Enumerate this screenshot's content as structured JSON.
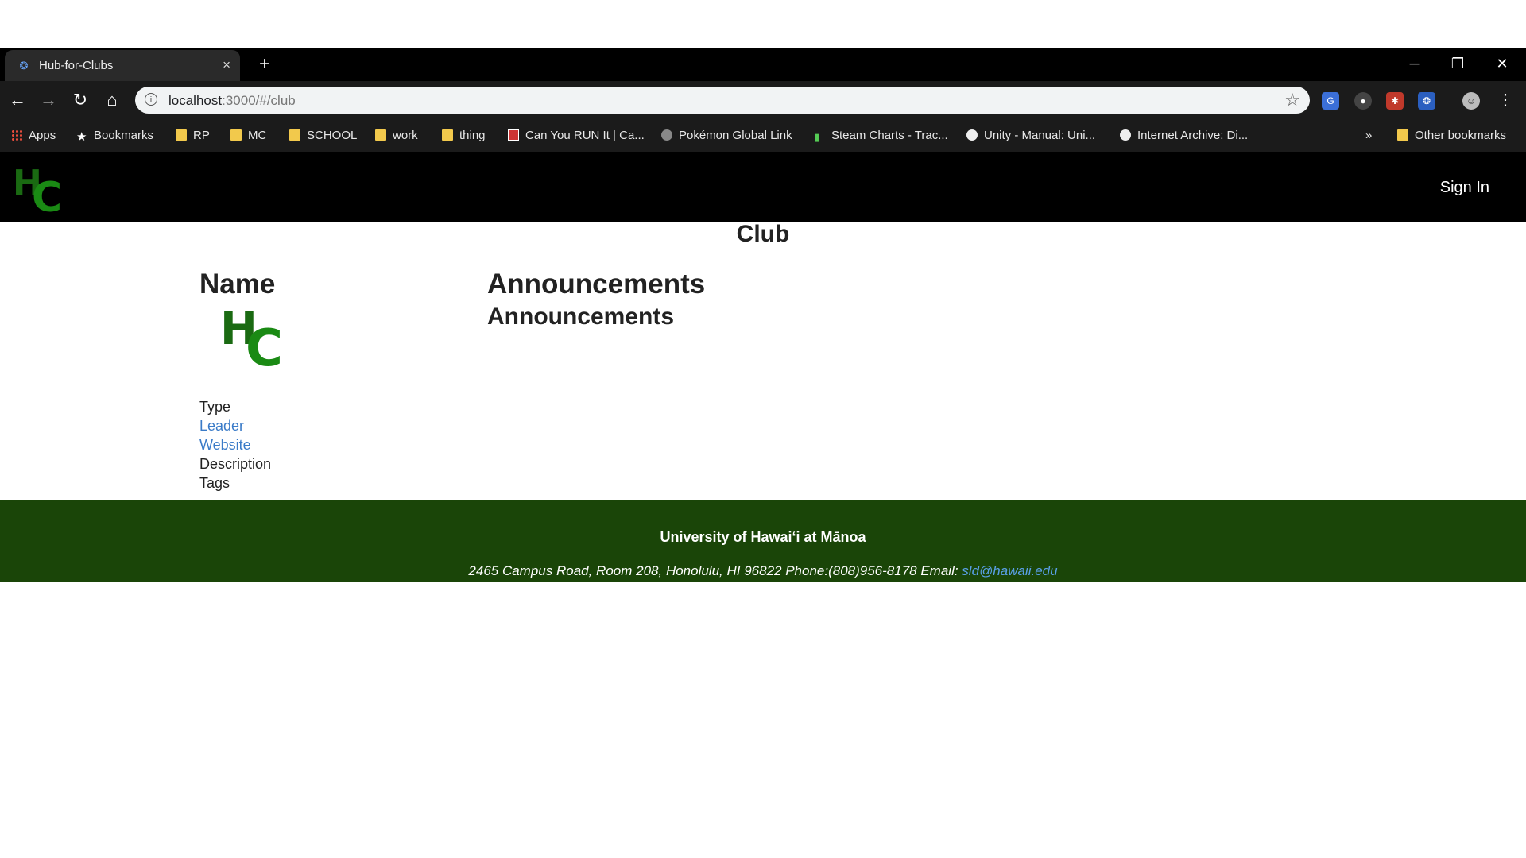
{
  "browser": {
    "tab_title": "Hub-for-Clubs",
    "tab_close": "×",
    "new_tab": "+",
    "url_host": "localhost",
    "url_path": ":3000/#/club",
    "window_controls": {
      "minimize": "─",
      "restore": "❐",
      "close": "✕"
    },
    "bookmarks": [
      {
        "label": "Apps",
        "icon": "apps-grid-icon"
      },
      {
        "label": "Bookmarks",
        "icon": "star-icon"
      },
      {
        "label": "RP",
        "icon": "folder-icon"
      },
      {
        "label": "MC",
        "icon": "folder-icon"
      },
      {
        "label": "SCHOOL",
        "icon": "folder-icon"
      },
      {
        "label": "work",
        "icon": "folder-icon"
      },
      {
        "label": "thing",
        "icon": "folder-icon"
      },
      {
        "label": "Can You RUN It | Ca...",
        "icon": "site-favicon"
      },
      {
        "label": "Pokémon Global Link",
        "icon": "pokeball-icon"
      },
      {
        "label": "Steam Charts - Trac...",
        "icon": "chart-icon"
      },
      {
        "label": "Unity - Manual: Uni...",
        "icon": "globe-icon"
      },
      {
        "label": "Internet Archive: Di...",
        "icon": "globe-icon"
      }
    ],
    "overflow": "»",
    "other_bookmarks": "Other bookmarks"
  },
  "navbar": {
    "logo_letters": "HC",
    "sign_in": "Sign In"
  },
  "page": {
    "title": "Club",
    "name_heading": "Name",
    "fields": {
      "type": "Type",
      "leader": "Leader",
      "website": "Website",
      "description": "Description",
      "tags": "Tags"
    },
    "announcements_heading": "Announcements",
    "announcements_subheading": "Announcements"
  },
  "footer": {
    "university": "University of Hawaiʻi at Mānoa",
    "address": "2465 Campus Road, Room 208, Honolulu, HI 96822 Phone:(808)956-8178   Email: ",
    "email": "sld@hawaii.edu"
  },
  "colors": {
    "footer_bg": "#1a4508",
    "logo_green": "#1a8a14",
    "link_blue": "#3a7bc8"
  }
}
